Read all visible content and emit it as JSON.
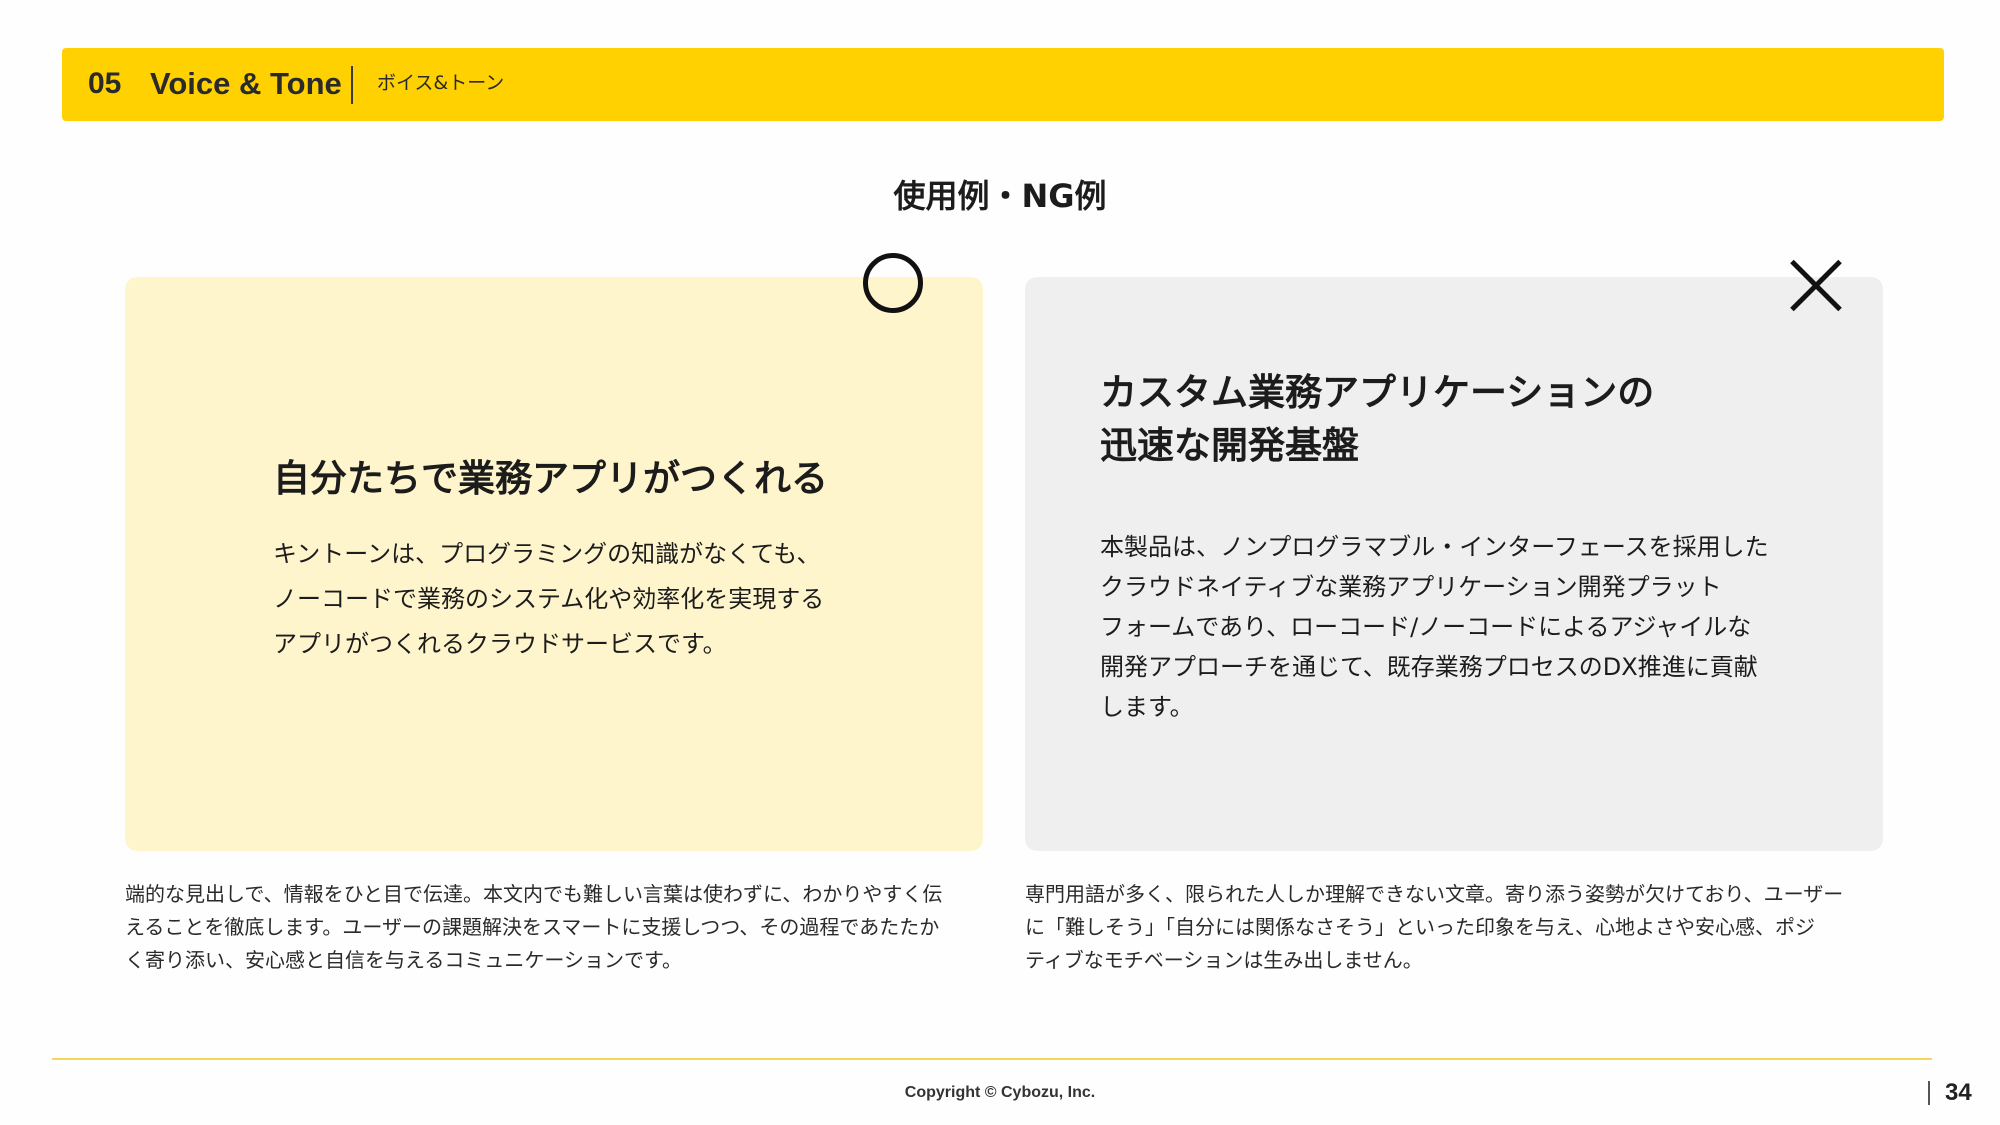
{
  "header": {
    "number": "05",
    "title": "Voice & Tone",
    "subtitle": "ボイス&トーン"
  },
  "page_heading": "使用例・NG例",
  "good_example": {
    "mark_icon": "circle-ok-icon",
    "headline": "自分たちで業務アプリがつくれる",
    "body_lines": [
      "キントーンは、プログラミングの知識がなくても、",
      "ノーコードで業務のシステム化や効率化を実現する",
      "アプリがつくれるクラウドサービスです。"
    ],
    "note_lines": [
      "端的な見出しで、情報をひと目で伝達。本文内でも難しい言葉は使わずに、わかりやすく伝",
      "えることを徹底します。ユーザーの課題解決をスマートに支援しつつ、その過程であたたか",
      "く寄り添い、安心感と自信を与えるコミュニケーションです。"
    ]
  },
  "bad_example": {
    "mark_icon": "cross-ng-icon",
    "headline_lines": [
      "カスタム業務アプリケーションの",
      "迅速な開発基盤"
    ],
    "body_lines": [
      "本製品は、ノンプログラマブル・インターフェースを採用した",
      "クラウドネイティブな業務アプリケーション開発プラット",
      "フォームであり、ローコード/ノーコードによるアジャイルな",
      "開発アプローチを通じて、既存業務プロセスのDX推進に貢献",
      "します。"
    ],
    "note_lines": [
      "専門用語が多く、限られた人しか理解できない文章。寄り添う姿勢が欠けており、ユーザー",
      "に「難しそう」「自分には関係なさそう」といった印象を与え、心地よさや安心感、ポジ",
      "ティブなモチベーションは生み出しません。"
    ]
  },
  "footer": {
    "copyright": "Copyright © Cybozu, Inc.",
    "page_number": "34"
  },
  "colors": {
    "accent_yellow": "#ffd100",
    "good_card_bg": "#fff5cc",
    "bad_card_bg": "#efefef"
  }
}
